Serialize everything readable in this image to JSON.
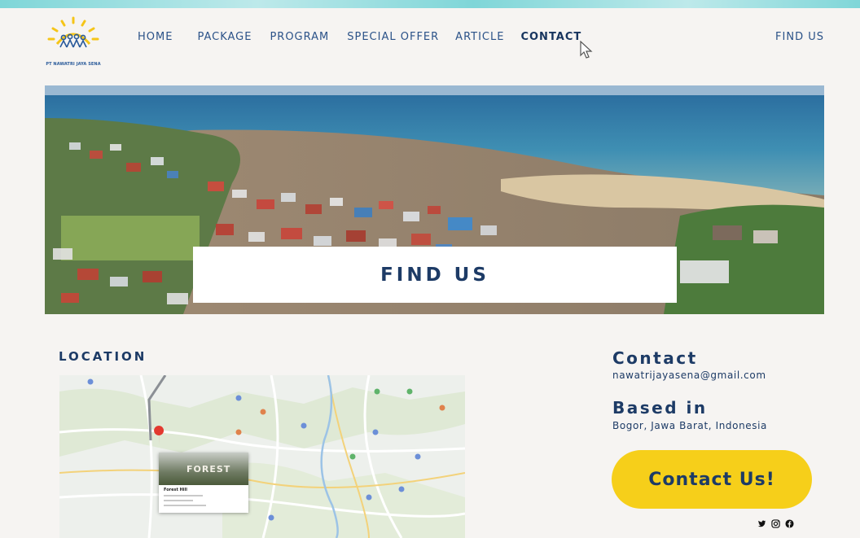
{
  "header": {
    "logo_text": "PT NAWATRI JAYA SENA",
    "nav": [
      {
        "label": "HOME"
      },
      {
        "label": "PACKAGE"
      },
      {
        "label": "PROGRAM"
      },
      {
        "label": "SPECIAL OFFER"
      },
      {
        "label": "ARTICLE"
      },
      {
        "label": "CONTACT",
        "active": true
      }
    ],
    "find_us_link": "FIND US"
  },
  "hero": {
    "title": "FIND US"
  },
  "location": {
    "heading": "LOCATION",
    "map_card": {
      "photo_label": "FOREST",
      "place_name": "Forest Hill"
    }
  },
  "contact": {
    "contact_heading": "Contact",
    "email": "nawatrijayasena@gmail.com",
    "based_heading": "Based in",
    "address": "Bogor, Jawa Barat, Indonesia",
    "cta_label": "Contact Us!"
  },
  "socials": [
    "twitter-icon",
    "instagram-icon",
    "facebook-icon"
  ],
  "colors": {
    "background": "#f6f4f2",
    "primary_text": "#1d3b66",
    "cta_yellow": "#f6cf1a",
    "logo_yellow": "#f5c518",
    "logo_blue": "#2a5a9a"
  }
}
